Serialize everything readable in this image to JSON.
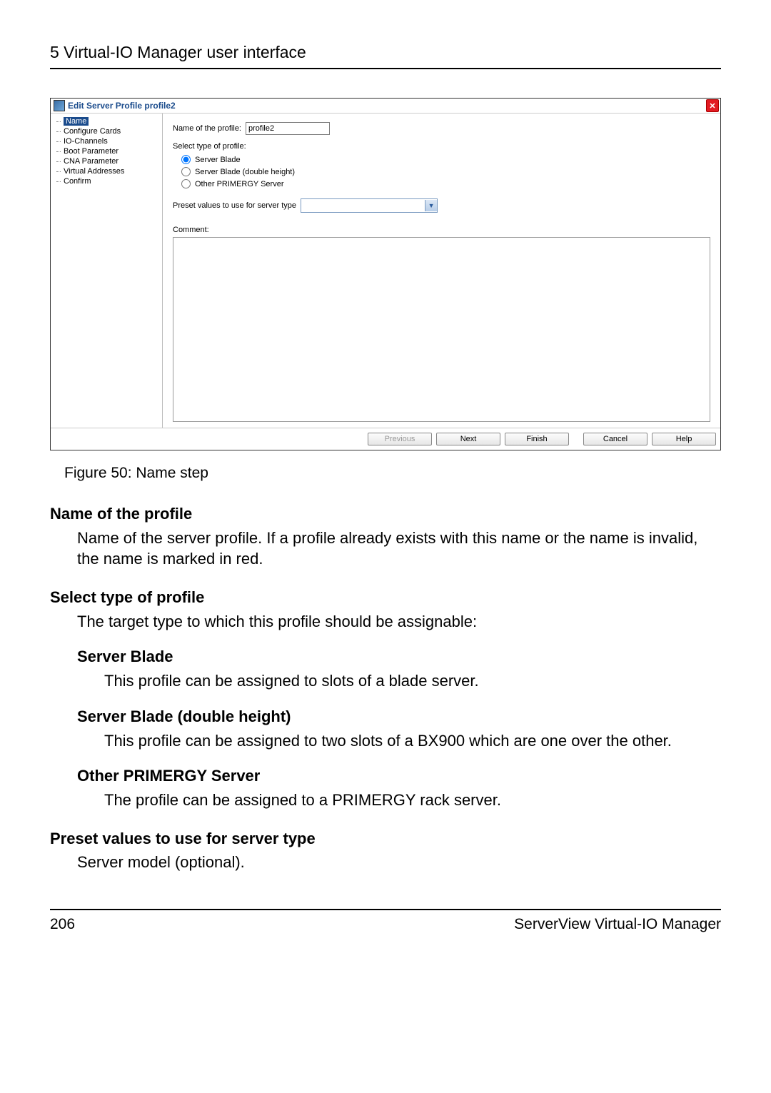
{
  "header": "5 Virtual-IO Manager user interface",
  "dialog": {
    "title": "Edit Server Profile profile2",
    "tree": {
      "items": [
        {
          "label": "Name",
          "selected": true
        },
        {
          "label": "Configure Cards",
          "selected": false
        },
        {
          "label": "IO-Channels",
          "selected": false
        },
        {
          "label": "Boot Parameter",
          "selected": false
        },
        {
          "label": "CNA Parameter",
          "selected": false
        },
        {
          "label": "Virtual Addresses",
          "selected": false
        },
        {
          "label": "Confirm",
          "selected": false
        }
      ]
    },
    "form": {
      "name_label": "Name of the profile:",
      "name_value": "profile2",
      "select_type_label": "Select type of profile:",
      "radio1": "Server Blade",
      "radio2": "Server Blade (double height)",
      "radio3": "Other PRIMERGY Server",
      "preset_label": "Preset values to use for server type",
      "comment_label": "Comment:"
    },
    "buttons": {
      "previous": "Previous",
      "next": "Next",
      "finish": "Finish",
      "cancel": "Cancel",
      "help": "Help"
    }
  },
  "caption": "Figure 50: Name step",
  "doc": {
    "name_term": "Name of the profile",
    "name_desc": "Name of the server profile. If a profile already exists with this name or the name is invalid, the name is marked in red.",
    "select_term": "Select type of profile",
    "select_desc": "The target type to which this profile should be assignable:",
    "sb_term": "Server Blade",
    "sb_desc": "This profile can be assigned to slots of a blade server.",
    "sbd_term": "Server Blade (double height)",
    "sbd_desc": "This profile can be assigned to two slots of a BX900 which are one over the other.",
    "ops_term": "Other PRIMERGY Server",
    "ops_desc": "The profile can be assigned to a PRIMERGY rack server.",
    "preset_term": "Preset values to use for server type",
    "preset_desc": "Server model (optional)."
  },
  "footer": {
    "page": "206",
    "product": "ServerView Virtual-IO Manager"
  }
}
